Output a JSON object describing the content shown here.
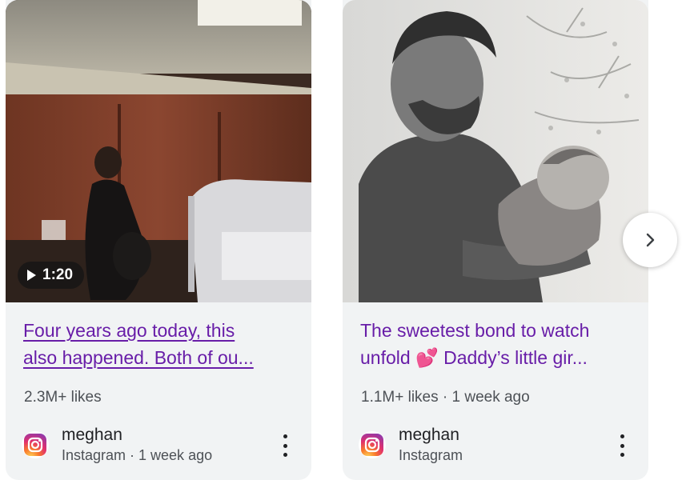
{
  "cards": [
    {
      "duration": "1:20",
      "title_lines": [
        "Four years ago today, this",
        "also happened. Both of ou..."
      ],
      "meta": "2.3M+ likes",
      "source_name": "meghan",
      "source_sub": "Instagram · 1 week ago",
      "thumbnail": "video-thumbnail-hospital-room"
    },
    {
      "title_lines": [
        "The sweetest bond to watch",
        "unfold 💕 Daddy’s little gir..."
      ],
      "meta": "1.1M+ likes · 1 week ago",
      "source_name": "meghan",
      "source_sub": "Instagram",
      "thumbnail": "photo-father-holding-baby"
    }
  ],
  "icons": {
    "source": "instagram-icon",
    "more": "more-vert-icon",
    "next": "chevron-right-icon"
  },
  "colors": {
    "visited_link": "#681da8",
    "card_bg": "#f1f3f4",
    "meta_text": "#4d5156"
  }
}
